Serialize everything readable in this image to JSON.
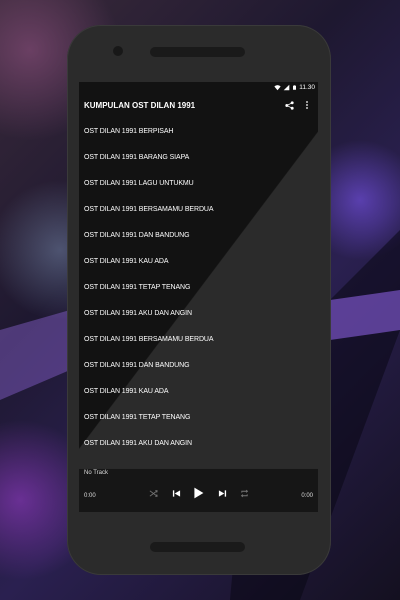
{
  "status_bar": {
    "time": "11.30",
    "icons": [
      "wifi-icon",
      "signal-icon",
      "battery-icon"
    ]
  },
  "app_bar": {
    "title": "KUMPULAN OST DILAN 1991",
    "actions": [
      "share-icon",
      "more-vert-icon"
    ]
  },
  "songs": [
    "OST DILAN 1991 BERPISAH",
    "OST DILAN 1991 BARANG SIAPA",
    "OST DILAN 1991 LAGU UNTUKMU",
    "OST DILAN 1991 BERSAMAMU BERDUA",
    "OST DILAN 1991 DAN BANDUNG",
    "OST DILAN 1991 KAU ADA",
    "OST DILAN 1991 TETAP TENANG",
    "OST DILAN 1991 AKU DAN ANGIN",
    "OST DILAN 1991 BERSAMAMU BERDUA",
    "OST DILAN 1991 DAN BANDUNG",
    "OST DILAN 1991 KAU ADA",
    "OST DILAN 1991 TETAP TENANG",
    "OST DILAN 1991 AKU DAN ANGIN"
  ],
  "player": {
    "track": "No Track",
    "elapsed": "0:00",
    "duration": "0:00",
    "controls": [
      "shuffle-icon",
      "previous-icon",
      "play-icon",
      "next-icon",
      "repeat-icon"
    ]
  },
  "colors": {
    "screen_bg": "#121212",
    "phone_body": "#2b2b2b",
    "text": "#ffffff"
  }
}
